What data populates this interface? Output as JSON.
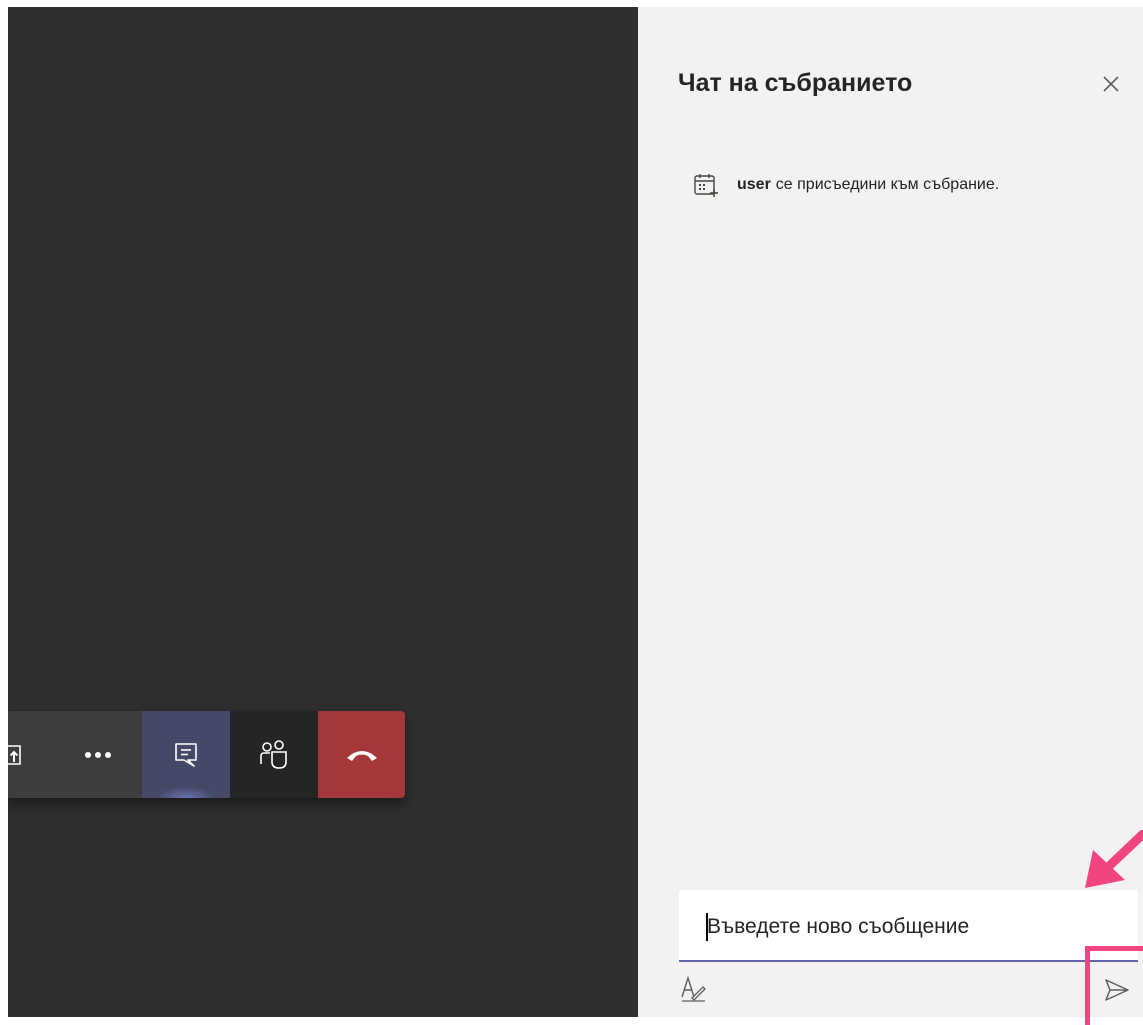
{
  "call_controls": {
    "icons": [
      "share-screen-icon",
      "more-options-icon",
      "chat-icon",
      "participants-icon",
      "hang-up-icon"
    ],
    "colors": {
      "toolbar": "#3d3d3d",
      "chat_active": "#454867",
      "leave": "#a4373a"
    }
  },
  "chat_panel": {
    "title": "Чат на събранието",
    "system_message": {
      "user": "user",
      "text": "се присъедини към събрание."
    },
    "compose": {
      "placeholder": "Въведете ново съобщение"
    }
  },
  "colors": {
    "stage_bg": "#2f2f2f",
    "panel_bg": "#f3f2f1",
    "accent": "#6264a7",
    "annotation": "#f0457d"
  }
}
